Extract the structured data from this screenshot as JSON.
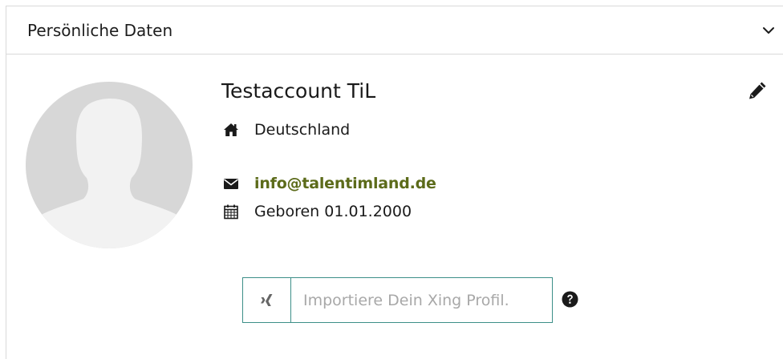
{
  "panel": {
    "title": "Persönliche Daten"
  },
  "profile": {
    "name": "Testaccount TiL",
    "country": "Deutschland",
    "email": "info@talentimland.de",
    "birth": "Geboren 01.01.2000"
  },
  "xing": {
    "placeholder": "Importiere Dein Xing Profil."
  },
  "icons": {
    "collapse": "chevron-down-icon",
    "edit": "pencil-icon",
    "country": "home-icon",
    "email": "envelope-icon",
    "birth": "calendar-icon",
    "xing": "xing-icon",
    "help": "question-circle-icon"
  },
  "colors": {
    "email_link": "#5c6b1a",
    "xing_border": "#3d8f88",
    "avatar_bg": "#d7d7d7"
  }
}
